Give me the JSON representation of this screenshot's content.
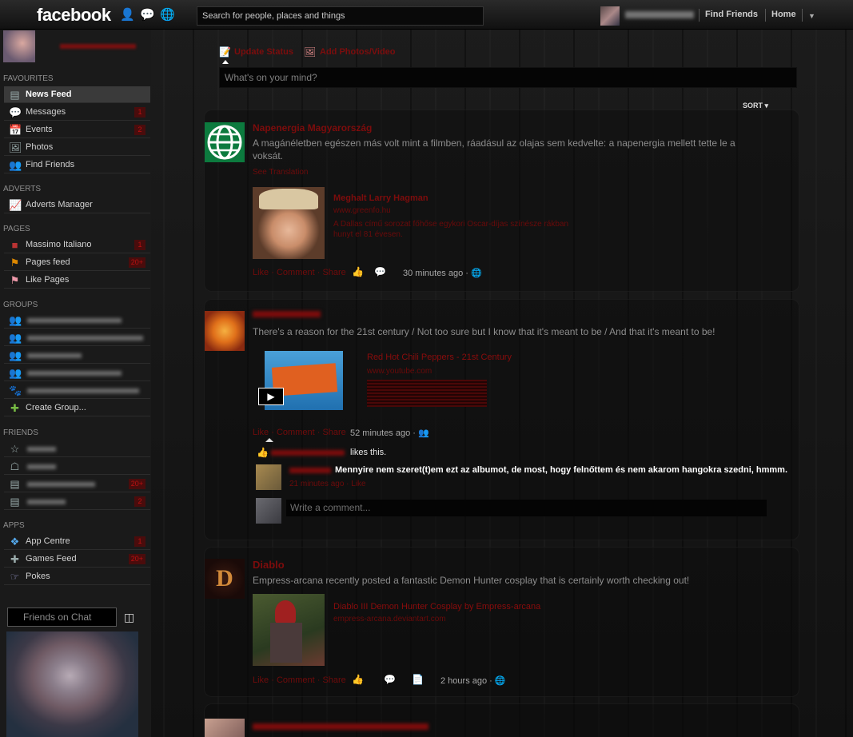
{
  "topbar": {
    "logo": "facebook",
    "search_placeholder": "Search for people, places and things",
    "find_friends": "Find Friends",
    "home": "Home"
  },
  "sidebar": {
    "sections": {
      "favourites": "FAVOURITES",
      "adverts": "ADVERTS",
      "pages": "PAGES",
      "groups": "GROUPS",
      "friends": "FRIENDS",
      "apps": "APPS"
    },
    "favourites": [
      {
        "label": "News Feed",
        "icon": "news-feed-icon"
      },
      {
        "label": "Messages",
        "icon": "messages-icon",
        "count": "1"
      },
      {
        "label": "Events",
        "icon": "events-icon",
        "count": "2"
      },
      {
        "label": "Photos",
        "icon": "photos-icon"
      },
      {
        "label": "Find Friends",
        "icon": "find-friends-icon"
      }
    ],
    "adverts": [
      {
        "label": "Adverts Manager",
        "icon": "adverts-icon"
      }
    ],
    "pages": [
      {
        "label": "Massimo Italiano",
        "icon": "page-icon",
        "count": "1"
      },
      {
        "label": "Pages feed",
        "icon": "pages-feed-icon",
        "count": "20+"
      },
      {
        "label": "Like Pages",
        "icon": "like-pages-icon"
      }
    ],
    "groups_create": "Create Group...",
    "friend_counts": [
      "20+",
      "2"
    ],
    "apps": [
      {
        "label": "App Centre",
        "icon": "app-centre-icon",
        "count": "1"
      },
      {
        "label": "Games Feed",
        "icon": "games-feed-icon",
        "count": "20+"
      },
      {
        "label": "Pokes",
        "icon": "pokes-icon"
      }
    ],
    "chat_placeholder": "Friends on Chat"
  },
  "composer": {
    "update_status": "Update Status",
    "add_photos": "Add Photos/Video",
    "placeholder": "What's on your mind?",
    "sort": "SORT"
  },
  "stories": [
    {
      "author": "Napenergia Magyarország",
      "text": "A magánéletben egészen más volt mint a filmben, ráadásul az olajas sem kedvelte: a napenergia mellett tette le a voksát.",
      "see_translation": "See Translation",
      "attachment_title": "Meghalt Larry Hagman",
      "attachment_source": "www.greenfo.hu",
      "attachment_desc": "A Dallas című sorozat főhőse egykori Oscar-díjas színésze rákban hunyt el 81 évesen.",
      "actions": [
        "Like",
        "Comment",
        "Share"
      ],
      "time": "30 minutes ago ·"
    },
    {
      "text": "There's a reason for the 21st century / Not too sure but I know that it's meant to be / And that it's meant to be!",
      "attachment_title": "Red Hot Chili Peppers - 21st Century",
      "attachment_source": "www.youtube.com",
      "actions": [
        "Like",
        "Comment",
        "Share"
      ],
      "time": "52 minutes ago ·",
      "likes_suffix": "likes this.",
      "comment": "Mennyire nem szeret(t)em ezt az albumot, de most, hogy felnőttem és nem akarom hangokra szedni, hmmm.",
      "comment_meta": "21 minutes ago · Like",
      "comment_placeholder": "Write a comment..."
    },
    {
      "author": "Diablo",
      "text": "Empress-arcana recently posted a fantastic Demon Hunter cosplay that is certainly worth checking out!",
      "attachment_title": "Diablo III Demon Hunter Cosplay by Empress-arcana",
      "attachment_source": "empress-arcana.deviantart.com",
      "actions": [
        "Like",
        "Comment",
        "Share"
      ],
      "time": "2 hours ago ·"
    }
  ],
  "colors": {
    "accent_red": "#7d0c0c",
    "count_badge": "#4a0c0c",
    "page_bg": "#151515"
  }
}
